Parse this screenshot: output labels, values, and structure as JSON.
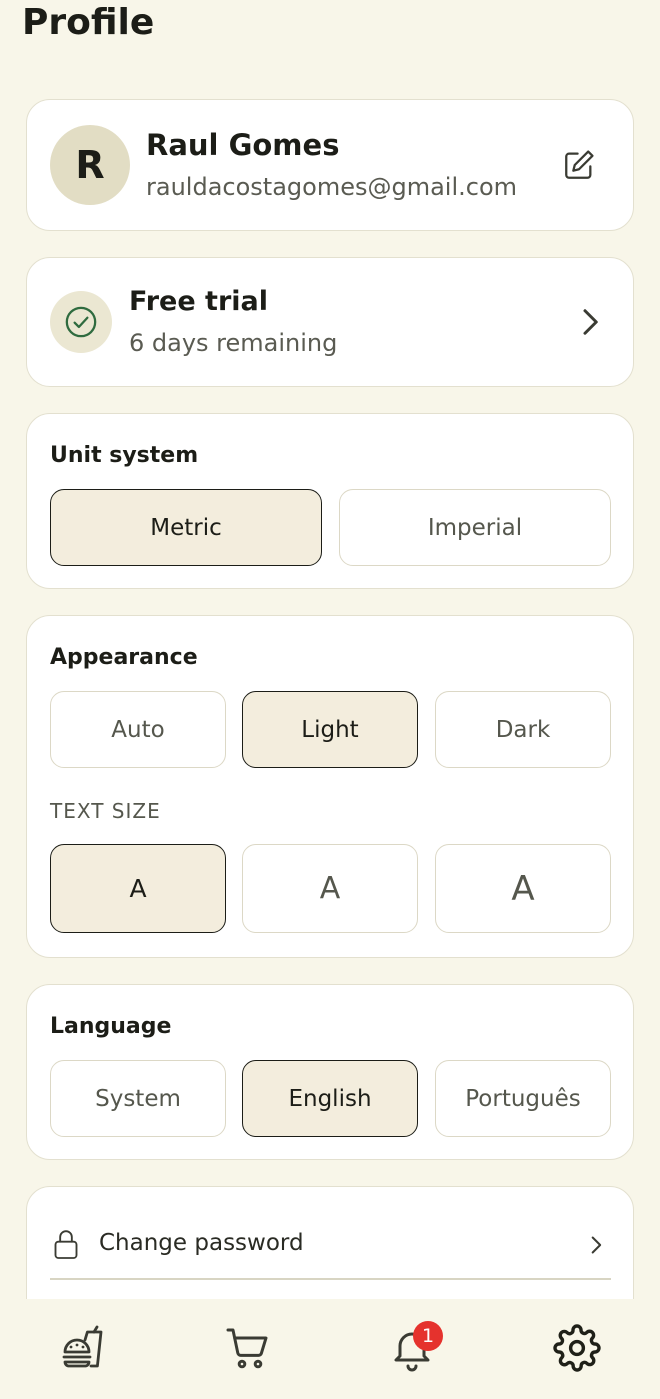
{
  "page": {
    "title": "Profile"
  },
  "profile": {
    "initial": "R",
    "name": "Raul Gomes",
    "email": "rauldacostagomes@gmail.com",
    "edit_icon": "edit-icon"
  },
  "trial": {
    "title": "Free trial",
    "subtitle": "6 days remaining",
    "icon": "check-circle-icon"
  },
  "unit_system": {
    "label": "Unit system",
    "options": [
      "Metric",
      "Imperial"
    ],
    "selected": "Metric"
  },
  "appearance": {
    "label": "Appearance",
    "options": [
      "Auto",
      "Light",
      "Dark"
    ],
    "selected": "Light",
    "text_size_label": "TEXT SIZE",
    "text_size_options": [
      "A",
      "A",
      "A"
    ],
    "text_size_selected_index": 0
  },
  "language": {
    "label": "Language",
    "options": [
      "System",
      "English",
      "Português"
    ],
    "selected": "English"
  },
  "account": {
    "change_password": "Change password"
  },
  "bottom_nav": {
    "items": [
      "food-icon",
      "cart-icon",
      "bell-icon",
      "gear-icon"
    ],
    "notification_count": "1"
  },
  "colors": {
    "background": "#f8f6e9",
    "selected_fill": "#f3eddd",
    "accent_check": "#2f6b3f",
    "badge": "#e5322d"
  }
}
